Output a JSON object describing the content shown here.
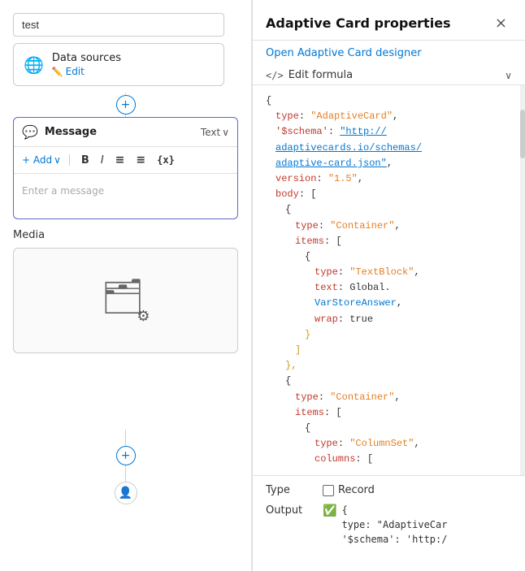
{
  "leftPanel": {
    "searchValue": "test",
    "dataSources": {
      "label": "Data sources",
      "editLabel": "Edit"
    },
    "addButton": "+",
    "messageCard": {
      "iconLabel": "💬",
      "title": "Message",
      "textLabel": "Text",
      "toolbar": {
        "addLabel": "+ Add",
        "boldLabel": "B",
        "italicLabel": "I",
        "listLabel": "≡",
        "orderedListLabel": "≡",
        "codeLabel": "{x}"
      },
      "placeholder": "Enter a message"
    },
    "mediaLabel": "Media",
    "bottomAdd": "+"
  },
  "rightPanel": {
    "title": "Adaptive Card properties",
    "closeLabel": "×",
    "designerLink": "Open Adaptive Card designer",
    "formulaBar": {
      "tag": "</>",
      "label": "Edit formula",
      "chevron": "∨"
    },
    "expandLabel": "↗",
    "code": {
      "line1": "{",
      "line2_key": "type",
      "line2_val": "\"AdaptiveCard\",",
      "line3_key": "'$schema'",
      "line3_val": "\"http://",
      "line4_val": "adaptivecards.io/schemas/",
      "line5_val": "adaptive-card.json\",",
      "line6_key": "version",
      "line6_val": "\"1.5\",",
      "line7_key": "body",
      "line7_val": "[",
      "line8": "{",
      "line9_key": "type",
      "line9_val": "\"Container\",",
      "line10_key": "items",
      "line10_val": "[",
      "line11": "{",
      "line12_key": "type",
      "line12_val": "\"TextBlock\",",
      "line13_key": "text",
      "line13_val": "Global.",
      "line14_var": "VarStoreAnswer",
      "line15_key": "wrap",
      "line15_val": "true",
      "line16": "}",
      "line17": "]",
      "line18": "},",
      "line19": "{",
      "line20_key": "type",
      "line20_val": "\"Container\",",
      "line21_key": "items",
      "line21_val": "[",
      "line22": "{",
      "line23_key": "type",
      "line23_val": "\"ColumnSet\",",
      "line24_key": "columns",
      "line24_val": "["
    },
    "bottomSection": {
      "typeLabel": "Type",
      "recordLabel": "Record",
      "outputLabel": "Output",
      "outputLine1": "{",
      "outputLine2": "type: \"AdaptiveCar",
      "outputLine3": "'$schema': 'http:/"
    }
  }
}
